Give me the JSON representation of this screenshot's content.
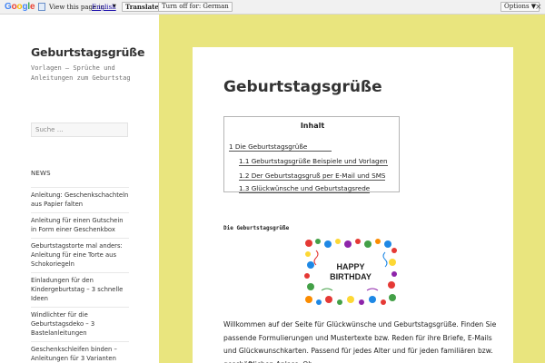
{
  "translate_bar": {
    "logo": "Google",
    "prompt": "View this page in:",
    "language": "English",
    "translate_label": "Translate",
    "turn_off_label": "Turn off for: German",
    "options_label": "Options ▼",
    "close_label": "×"
  },
  "sidebar": {
    "site_title": "Geburtstagsgrüße",
    "site_description": "Vorlagen – Sprüche und Anleitungen zum Geburtstag",
    "search_placeholder": "Suche …",
    "news_title": "NEWS",
    "news_items": [
      "Anleitung: Geschenkschachteln aus Papier falten",
      "Anleitung für einen Gutschein in Form einer Geschenkbox",
      "Geburtstagstorte mal anders: Anleitung für eine Torte aus Schokoriegeln",
      "Einladungen für den Kindergeburtstag – 3 schnelle Ideen",
      "Windlichter für die Geburtstagsdeko – 3 Bastelanleitungen",
      "Geschenkschleifen binden – Anleitungen für 3 Varianten"
    ]
  },
  "article": {
    "title": "Geburtstagsgrüße",
    "toc_title": "Inhalt",
    "toc_items": [
      "1 Die Geburtstagsgrüße",
      "1.1 Geburtstagsgrüße Beispiele und Vorlagen",
      "1.2 Der Geburtstagsgruß per E-Mail und SMS",
      "1.3 Glückwünsche und Geburtstagsrede"
    ],
    "section_heading": "Die Geburtstagsgrüße",
    "banner_text_line1": "HAPPY",
    "banner_text_line2": "BIRTHDAY",
    "intro_text": "Willkommen auf der Seite für Glückwünsche und Geburtstagsgrüße. Finden Sie passende Formulierungen und Mustertexte bzw. Reden für ihre Briefe, E-Mails und Glückwunschkarten. Passend für jedes Alter und für jeden familiären bzw. geschäftlichen Anlass. Ob"
  },
  "colors": {
    "background": "#e9e57e",
    "link_blue": "#1a0dab",
    "text": "#333333"
  }
}
